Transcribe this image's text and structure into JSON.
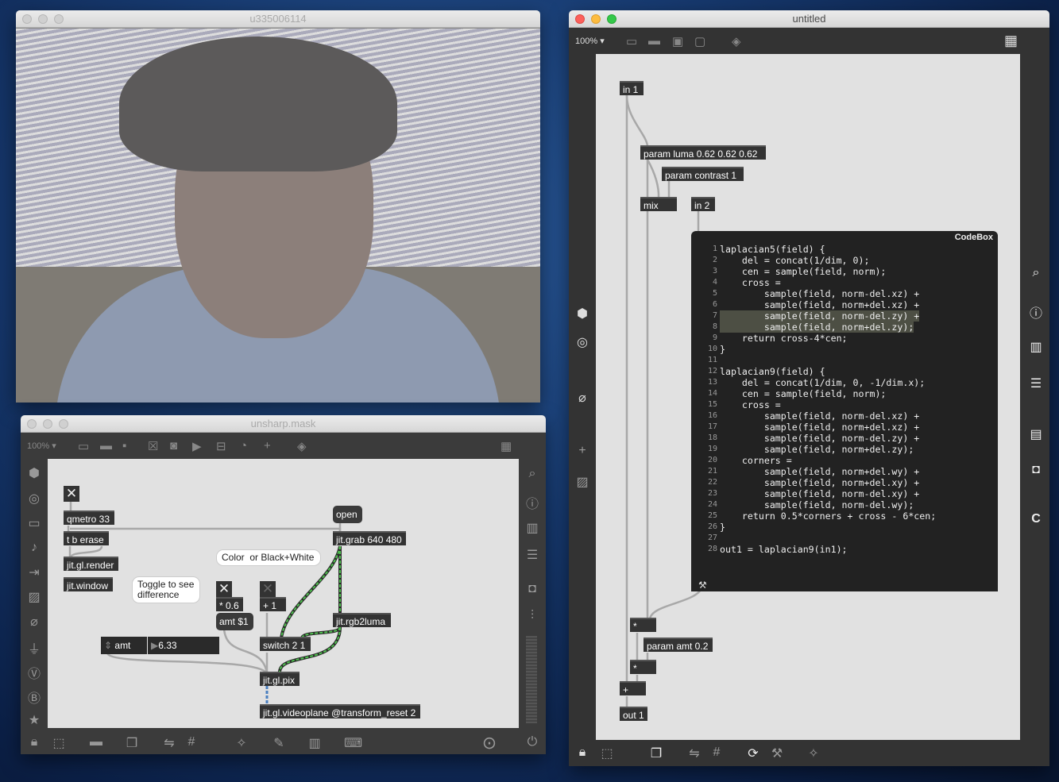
{
  "video_window": {
    "title": "u335006114"
  },
  "unsharp_window": {
    "title": "unsharp.mask",
    "zoom": "100% ▾",
    "objects": {
      "qmetro": "qmetro 33",
      "tberase": "t b erase",
      "render": "jit.gl.render",
      "window": "jit.window",
      "open": "open",
      "grab": "jit.grab 640 480",
      "mul": "* 0.6",
      "plus": "+ 1",
      "amt_msg": "amt $1",
      "rgb2luma": "jit.rgb2luma",
      "amt_label": "amt",
      "amt_value": "6.33",
      "switch": "switch 2 1",
      "pix": "jit.gl.pix",
      "videoplane": "jit.gl.videoplane @transform_reset 2"
    },
    "comments": {
      "color": "Color  or Black+White",
      "toggle": "Toggle to see difference"
    },
    "toggles": {
      "main": true,
      "diff": true,
      "color": false
    }
  },
  "untitled_window": {
    "title": "untitled",
    "zoom": "100% ▾",
    "objects": {
      "in1": "in 1",
      "luma": "param luma 0.62 0.62 0.62",
      "contrast": "param contrast 1",
      "mix": "mix",
      "in2": "in 2",
      "mul1": "*",
      "amt": "param amt 0.2",
      "mul2": "*",
      "add": "+",
      "out1": "out 1"
    },
    "codebox": {
      "label": "CodeBox",
      "highlighted_lines": [
        7,
        8
      ],
      "lines": [
        "laplacian5(field) {",
        "    del = concat(1/dim, 0);",
        "    cen = sample(field, norm);",
        "    cross =",
        "        sample(field, norm-del.xz) +",
        "        sample(field, norm+del.xz) +",
        "        sample(field, norm-del.zy) +",
        "        sample(field, norm+del.zy);",
        "    return cross-4*cen;",
        "}",
        "",
        "laplacian9(field) {",
        "    del = concat(1/dim, 0, -1/dim.x);",
        "    cen = sample(field, norm);",
        "    cross =",
        "        sample(field, norm-del.xz) +",
        "        sample(field, norm+del.xz) +",
        "        sample(field, norm-del.zy) +",
        "        sample(field, norm+del.zy);",
        "    corners =",
        "        sample(field, norm+del.wy) +",
        "        sample(field, norm+del.xy) +",
        "        sample(field, norm-del.xy) +",
        "        sample(field, norm-del.wy);",
        "    return 0.5*corners + cross - 6*cen;",
        "}",
        "",
        "out1 = laplacian9(in1);"
      ]
    }
  },
  "colors": {
    "cord": "#a8a8a8",
    "jitter_cord": "#3fae3f",
    "gl_cord": "#4a7fc0",
    "object": "#333333",
    "canvas": "#e1e1e1"
  }
}
